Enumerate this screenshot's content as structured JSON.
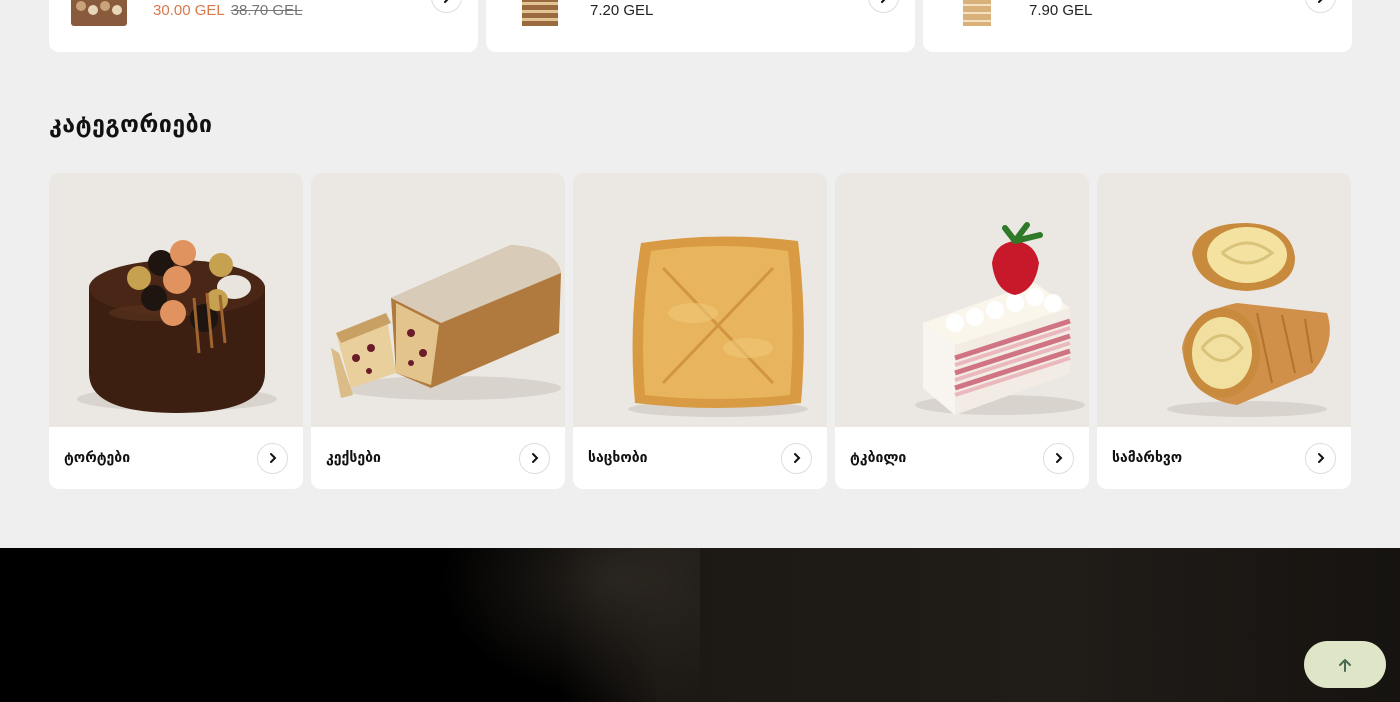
{
  "products": [
    {
      "price": "30.00 GEL",
      "old_price": "38.70 GEL",
      "image": "chocolate-box-image"
    },
    {
      "price": "7.20 GEL",
      "image": "layer-cake-slice-image"
    },
    {
      "price": "7.90 GEL",
      "image": "honey-cake-slice-image"
    }
  ],
  "categories_title": "კატეგორიები",
  "categories": [
    {
      "label": "ტორტები",
      "image": "chocolate-cake-image"
    },
    {
      "label": "კექსები",
      "image": "fruit-loaf-image"
    },
    {
      "label": "საცხობი",
      "image": "pie-image"
    },
    {
      "label": "ტკბილი",
      "image": "strawberry-pastry-image"
    },
    {
      "label": "სამარხვო",
      "image": "cream-horns-image"
    }
  ],
  "colors": {
    "sale_price": "#d9794a",
    "background": "#efefef",
    "scroll_top_button": "#dfe6c8"
  },
  "icons": {
    "card_arrow": "chevron-right-icon",
    "scroll_top": "arrow-up-icon"
  }
}
